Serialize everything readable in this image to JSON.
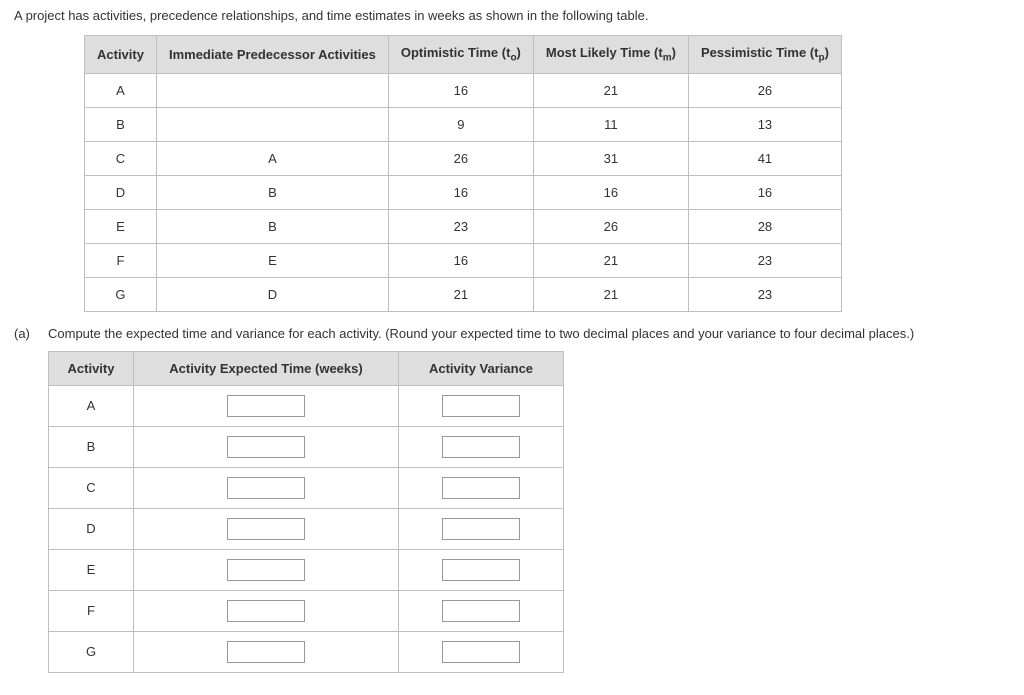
{
  "intro": "A project has activities, precedence relationships, and time estimates in weeks as shown in the following table.",
  "table1": {
    "headers": {
      "activity": "Activity",
      "predecessor": "Immediate Predecessor Activities",
      "optimistic_pre": "Optimistic Time (t",
      "optimistic_sub": "o",
      "optimistic_post": ")",
      "mostlikely_pre": "Most Likely Time (t",
      "mostlikely_sub": "m",
      "mostlikely_post": ")",
      "pessimistic_pre": "Pessimistic Time (t",
      "pessimistic_sub": "p",
      "pessimistic_post": ")"
    },
    "rows": [
      {
        "activity": "A",
        "pred": "",
        "to": "16",
        "tm": "21",
        "tp": "26"
      },
      {
        "activity": "B",
        "pred": "",
        "to": "9",
        "tm": "11",
        "tp": "13"
      },
      {
        "activity": "C",
        "pred": "A",
        "to": "26",
        "tm": "31",
        "tp": "41"
      },
      {
        "activity": "D",
        "pred": "B",
        "to": "16",
        "tm": "16",
        "tp": "16"
      },
      {
        "activity": "E",
        "pred": "B",
        "to": "23",
        "tm": "26",
        "tp": "28"
      },
      {
        "activity": "F",
        "pred": "E",
        "to": "16",
        "tm": "21",
        "tp": "23"
      },
      {
        "activity": "G",
        "pred": "D",
        "to": "21",
        "tm": "21",
        "tp": "23"
      }
    ]
  },
  "question_a": {
    "label": "(a)",
    "text": "Compute the expected time and variance for each activity. (Round your expected time to two decimal places and your variance to four decimal places.)"
  },
  "table2": {
    "headers": {
      "activity": "Activity",
      "expected": "Activity Expected Time (weeks)",
      "variance": "Activity Variance"
    },
    "rows": [
      {
        "activity": "A"
      },
      {
        "activity": "B"
      },
      {
        "activity": "C"
      },
      {
        "activity": "D"
      },
      {
        "activity": "E"
      },
      {
        "activity": "F"
      },
      {
        "activity": "G"
      }
    ]
  }
}
